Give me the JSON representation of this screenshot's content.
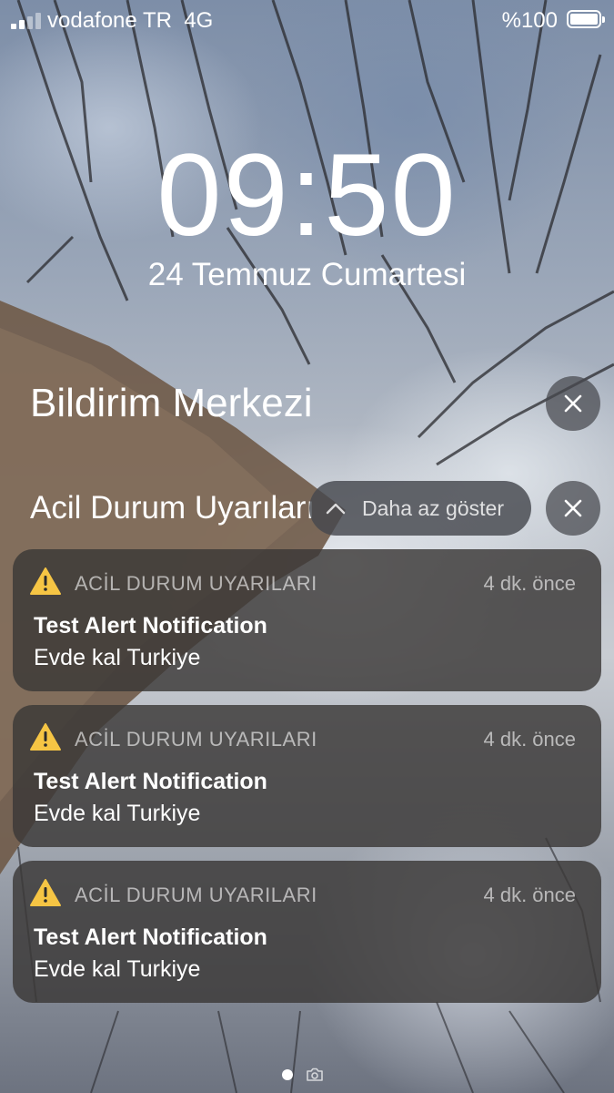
{
  "status_bar": {
    "carrier": "vodafone TR",
    "network": "4G",
    "battery_percent": "%100",
    "signal_bars": 4,
    "signal_bars_active": 2
  },
  "lock_screen": {
    "time": "09:50",
    "date": "24 Temmuz Cumartesi"
  },
  "notification_center": {
    "title": "Bildirim Merkezi",
    "close_icon": "close-icon"
  },
  "group": {
    "title": "Acil Durum Uyarıları",
    "show_less_label": "Daha az göster",
    "close_icon": "close-icon"
  },
  "notifications": [
    {
      "app": "ACİL DURUM UYARILARI",
      "time": "4 dk. önce",
      "title": "Test Alert Notification",
      "body": "Evde kal Turkiye",
      "icon": "warning-icon"
    },
    {
      "app": "ACİL DURUM UYARILARI",
      "time": "4 dk. önce",
      "title": "Test Alert Notification",
      "body": "Evde kal Turkiye",
      "icon": "warning-icon"
    },
    {
      "app": "ACİL DURUM UYARILARI",
      "time": "4 dk. önce",
      "title": "Test Alert Notification",
      "body": "Evde kal Turkiye",
      "icon": "warning-icon"
    }
  ],
  "page_indicator": {
    "pages": 2,
    "current": 1,
    "camera_icon": "camera-icon"
  },
  "colors": {
    "warning": "#f6c544",
    "card_background": "#3a3837"
  }
}
